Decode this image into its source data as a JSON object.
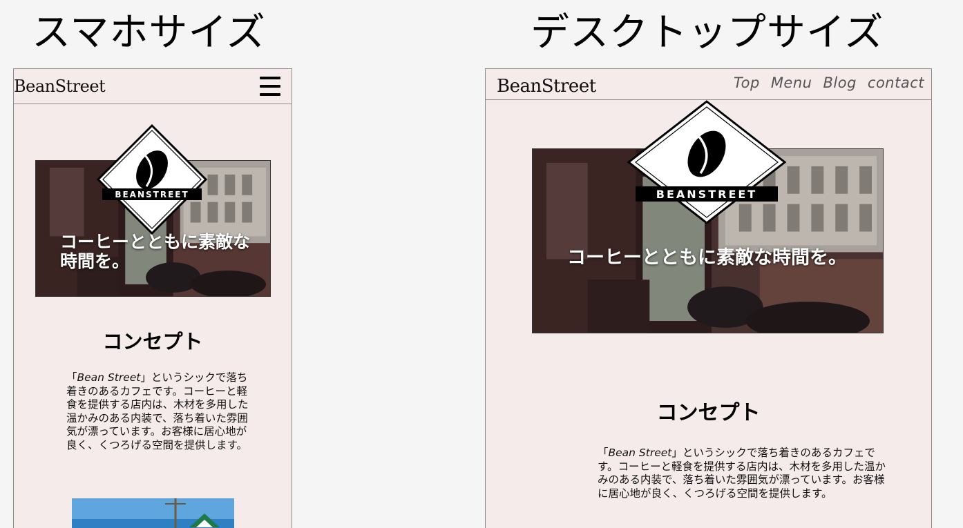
{
  "headings": {
    "mobile": "スマホサイズ",
    "desktop": "デスクトップサイズ"
  },
  "site": {
    "logo": "BeanStreet",
    "badge_text": "BEANSTREET"
  },
  "nav": {
    "items": [
      "Top",
      "Menu",
      "Blog",
      "contact"
    ]
  },
  "hero": {
    "tagline": "コーヒーとともに素敵な時間を。"
  },
  "concept": {
    "title": "コンセプト",
    "body_quote_open": "「",
    "body_name": "Bean Street",
    "body_rest": "」というシックで落ち着きのあるカフェです。コーヒーと軽食を提供する店内は、木材を多用した温かみのある内装で、落ち着いた雰囲気が漂っています。お客様に居心地が良く、くつろげる空間を提供します。"
  },
  "icons": {
    "menu": "hamburger-icon",
    "badge": "coffee-bean-icon"
  },
  "colors": {
    "page_bg": "#f5f5f5",
    "frame_bg": "#f5ebea",
    "border": "#8a8a8a",
    "nav_text": "#555555"
  }
}
